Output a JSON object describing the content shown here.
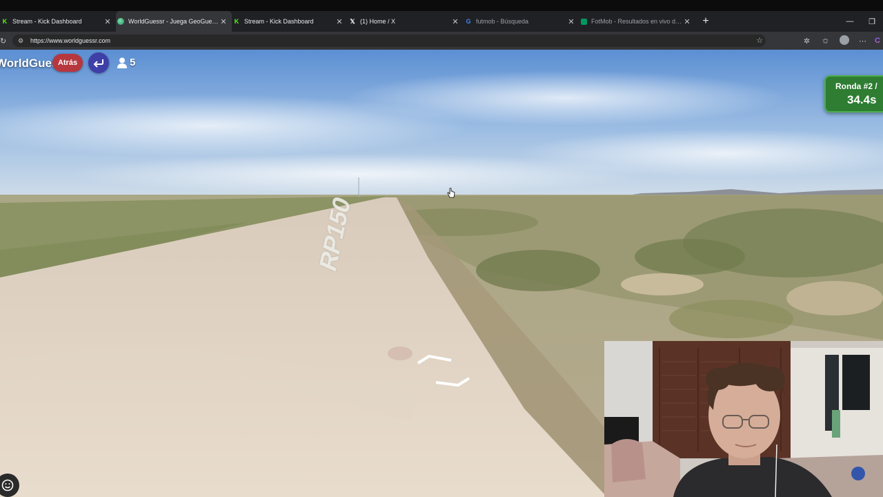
{
  "browser": {
    "tabs": [
      {
        "title": "Stream - Kick Dashboard",
        "favicon": "kick-icon",
        "active": false
      },
      {
        "title": "WorldGuessr - Juega GeoGuessr gratis",
        "favicon": "globe-icon",
        "active": true
      },
      {
        "title": "Stream - Kick Dashboard",
        "favicon": "kick-icon",
        "active": false
      },
      {
        "title": "(1) Home / X",
        "favicon": "x-icon",
        "active": false
      },
      {
        "title": "futmob - Búsqueda",
        "favicon": "google-icon",
        "active": false
      },
      {
        "title": "FotMob - Resultados en vivo de fútbol",
        "favicon": "fotmob-icon",
        "active": false
      }
    ],
    "new_tab": "+",
    "url": "https://www.worldguessr.com"
  },
  "game": {
    "brand": "WorldGuessr",
    "back_label": "Atrás",
    "players_count": "5",
    "round_label": "Ronda #2 /",
    "timer": "34.4s",
    "road_marking": "RP150"
  },
  "colors": {
    "atras_button": "#b7373f",
    "return_button": "#3f3fa8",
    "round_box": "#2e7d32",
    "tab_strip": "#202124",
    "active_tab": "#35363a"
  }
}
